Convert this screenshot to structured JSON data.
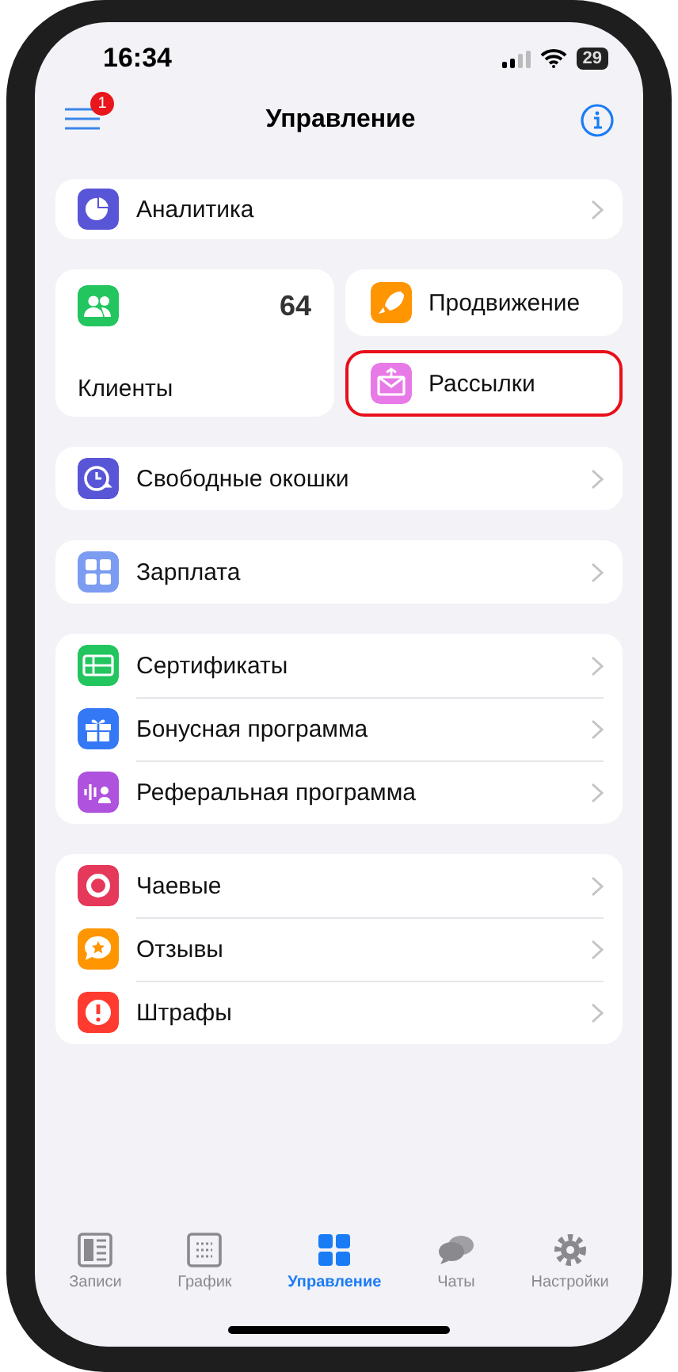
{
  "status_bar": {
    "time": "16:34",
    "battery": "29"
  },
  "nav": {
    "title": "Управление",
    "menu_badge": "1"
  },
  "analytics": {
    "label": "Аналитика",
    "kind": "analytics"
  },
  "clients": {
    "label": "Клиенты",
    "count": "64",
    "kind": "people"
  },
  "tiles": [
    {
      "label": "Продвижение",
      "kind": "rocket",
      "highlighted": false
    },
    {
      "label": "Рассылки",
      "kind": "mail",
      "highlighted": true
    }
  ],
  "groups": [
    [
      {
        "label": "Свободные окошки",
        "kind": "clock"
      }
    ],
    [
      {
        "label": "Зарплата",
        "kind": "calc"
      }
    ],
    [
      {
        "label": "Сертификаты",
        "kind": "cert"
      },
      {
        "label": "Бонусная программа",
        "kind": "gift"
      },
      {
        "label": "Реферальная программа",
        "kind": "referral"
      }
    ],
    [
      {
        "label": "Чаевые",
        "kind": "tips"
      },
      {
        "label": "Отзывы",
        "kind": "review"
      },
      {
        "label": "Штрафы",
        "kind": "fine"
      }
    ]
  ],
  "tab_bar": [
    {
      "label": "Записи",
      "kind": "records",
      "selected": false
    },
    {
      "label": "График",
      "kind": "schedule",
      "selected": false
    },
    {
      "label": "Управление",
      "kind": "grid",
      "selected": true
    },
    {
      "label": "Чаты",
      "kind": "chats",
      "selected": false
    },
    {
      "label": "Настройки",
      "kind": "settings",
      "selected": false
    }
  ]
}
